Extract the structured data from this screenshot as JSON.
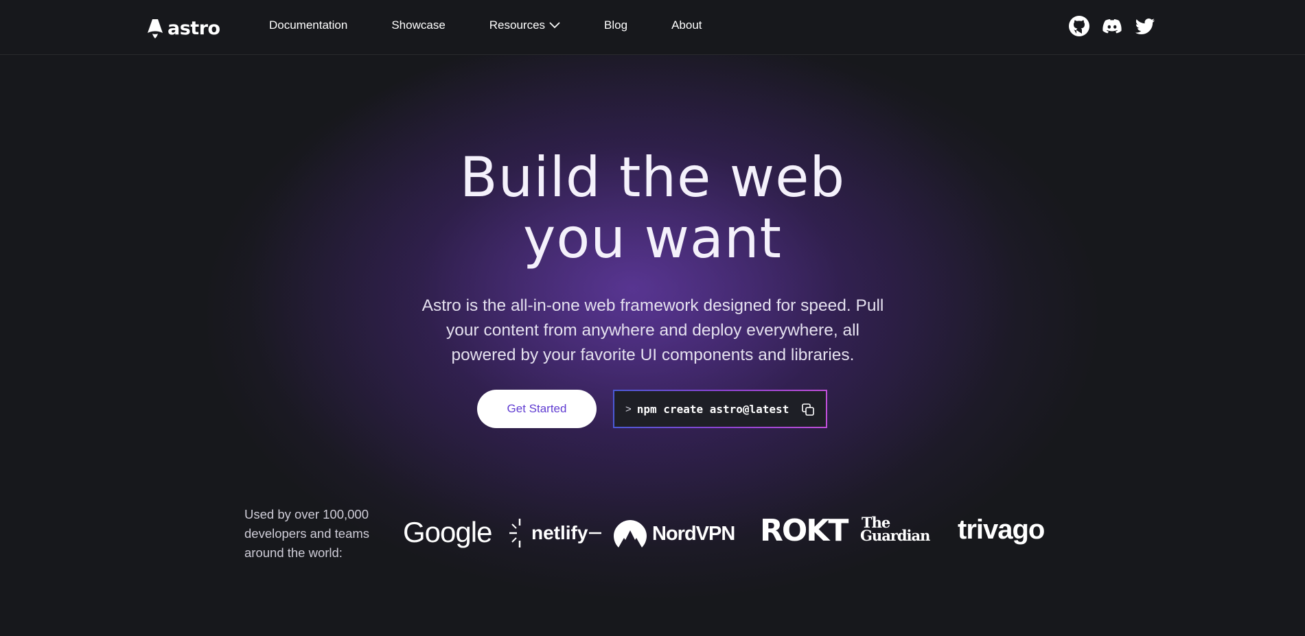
{
  "brand": {
    "name": "astro"
  },
  "nav": {
    "items": [
      {
        "label": "Documentation"
      },
      {
        "label": "Showcase"
      },
      {
        "label": "Resources"
      },
      {
        "label": "Blog"
      },
      {
        "label": "About"
      }
    ]
  },
  "social": {
    "icons": [
      "github-icon",
      "discord-icon",
      "twitter-icon"
    ]
  },
  "hero": {
    "title_line1": "Build the web",
    "title_line2": "you want",
    "subtitle_line1": "Astro is the all-in-one web framework designed for speed. Pull",
    "subtitle_line2": "your content from anywhere and deploy everywhere, all",
    "subtitle_line3": "powered by your favorite UI components and libraries.",
    "cta_label": "Get Started",
    "command_prompt": ">",
    "command": "npm create astro@latest"
  },
  "used_by": {
    "text_line1": "Used by over 100,000",
    "text_line2": "developers and teams",
    "text_line3": "around the world:",
    "logos": {
      "google": "Google",
      "netlify": "netlify",
      "nordvpn": "NordVPN",
      "rokt": "ROKT",
      "guardian_line1": "The",
      "guardian_line2": "Guardian",
      "trivago": "trivago"
    }
  },
  "colors": {
    "background": "#17181c",
    "accent_purple": "#5f3bd1",
    "glow": "#7846c8"
  }
}
